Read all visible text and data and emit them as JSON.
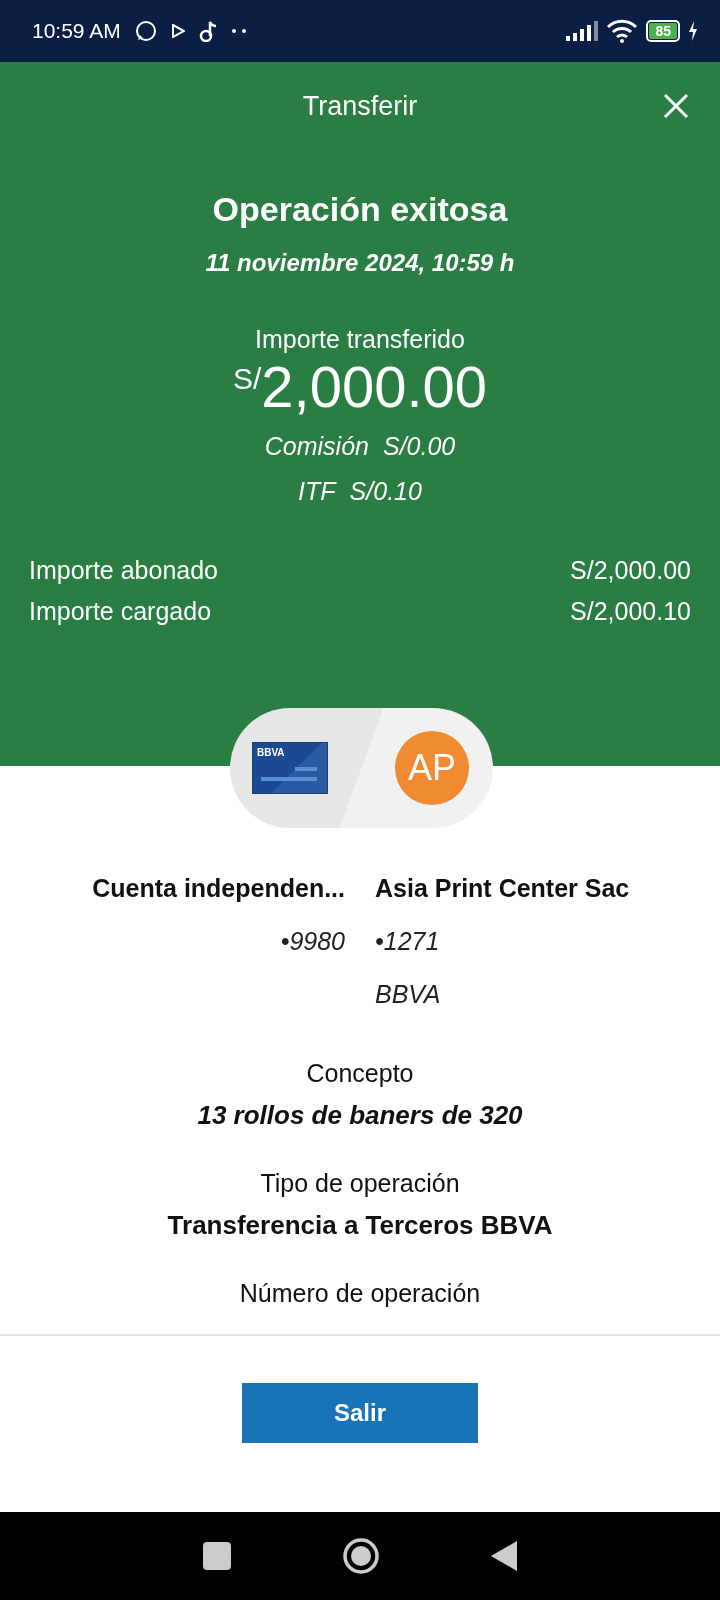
{
  "status_bar": {
    "time": "10:59 AM",
    "battery": "85"
  },
  "header": {
    "title": "Transferir"
  },
  "result": {
    "title": "Operación exitosa",
    "date": "11 noviembre 2024, 10:59 h",
    "amount_label": "Importe transferido",
    "currency": "S/",
    "amount": "2,000.00",
    "fees": [
      {
        "label": "Comisión",
        "value": "S/0.00"
      },
      {
        "label": "ITF",
        "value": "S/0.10"
      }
    ]
  },
  "totals": [
    {
      "label": "Importe abonado",
      "value": "S/2,000.00"
    },
    {
      "label": "Importe cargado",
      "value": "S/2,000.10"
    }
  ],
  "origin": {
    "card_logo": "BBVA",
    "name": "Cuenta independen...",
    "account": "•9980"
  },
  "destination": {
    "initials": "AP",
    "name": "Asia Print Center Sac",
    "account": "•1271",
    "bank": "BBVA"
  },
  "details": [
    {
      "label": "Concepto",
      "value": "13 rollos de baners de 320",
      "italic": true
    },
    {
      "label": "Tipo de operación",
      "value": "Transferencia a Terceros BBVA",
      "italic": false
    },
    {
      "label": "Número de operación"
    }
  ],
  "button": {
    "label": "Salir"
  }
}
